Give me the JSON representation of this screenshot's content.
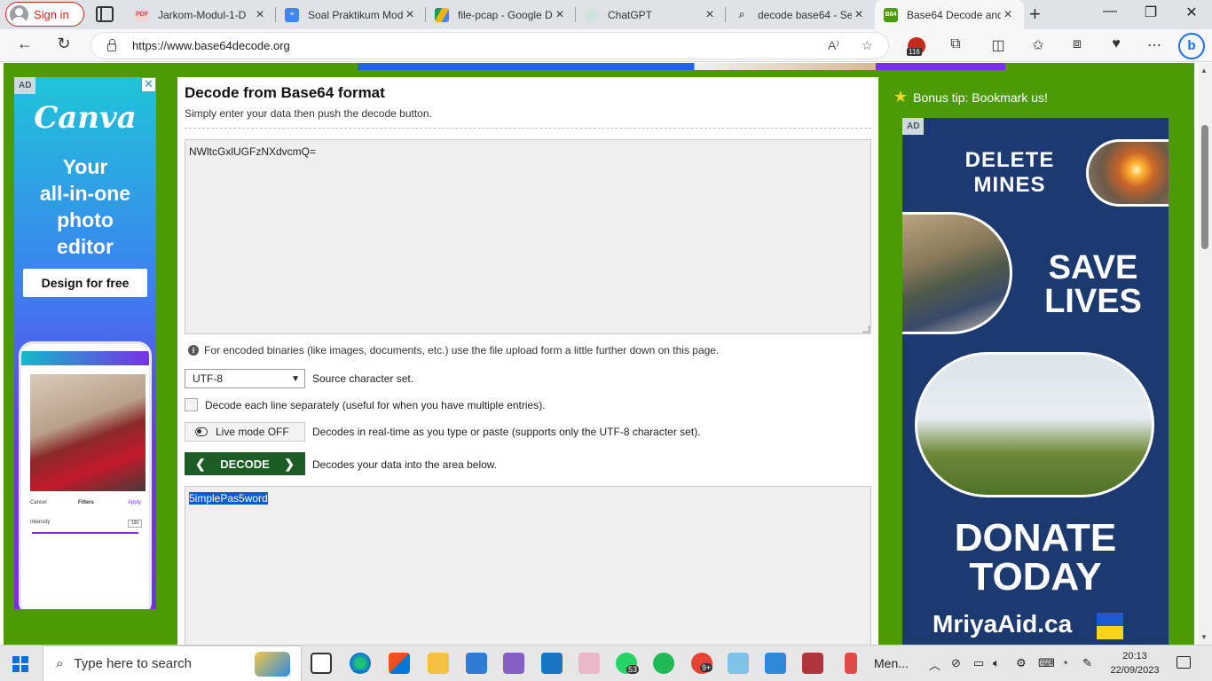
{
  "browser": {
    "signin_label": "Sign in",
    "tabs": [
      {
        "title": "Jarkom-Modul-1-D",
        "favicon": "pdf-icon",
        "color": "#d24a3c"
      },
      {
        "title": "Soal Praktikum Mod",
        "favicon": "google-docs-icon",
        "color": "#4285f4"
      },
      {
        "title": "file-pcap - Google D",
        "favicon": "google-drive-icon",
        "color": "#0f9d58"
      },
      {
        "title": "ChatGPT",
        "favicon": "chatgpt-icon",
        "color": "#74aa9c"
      },
      {
        "title": "decode base64 - Se",
        "favicon": "search-icon",
        "color": "#888888"
      },
      {
        "title": "Base64 Decode and",
        "favicon": "base64-icon",
        "color": "#4b9a06",
        "active": true
      }
    ],
    "url": "https://www.base64decode.org",
    "extension_badge": "116"
  },
  "page": {
    "title": "Decode from Base64 format",
    "subtitle": "Simply enter your data then push the decode button.",
    "input_value": "NWltcGxlUGFzNXdvcmQ=",
    "info_text": "For encoded binaries (like images, documents, etc.) use the file upload form a little further down on this page.",
    "charset_value": "UTF-8",
    "charset_label": "Source character set.",
    "each_line_label": "Decode each line separately (useful for when you have multiple entries).",
    "live_mode_label": "Live mode OFF",
    "live_mode_desc": "Decodes in real-time as you type or paste (supports only the UTF-8 character set).",
    "decode_button": "DECODE",
    "decode_desc": "Decodes your data into the area below.",
    "output_value": "5implePas5word",
    "bonus_tip": "Bonus tip: Bookmark us!"
  },
  "ad_left": {
    "tag": "AD",
    "close": "✕",
    "brand": "Canva",
    "headline_lines": [
      "Your",
      "all-in-one",
      "photo",
      "editor"
    ],
    "cta": "Design for free",
    "phone_cancel": "Cancel",
    "phone_filters": "Filters",
    "phone_apply": "Apply",
    "phone_intensity": "Intensity",
    "phone_intensity_value": "100"
  },
  "ad_right": {
    "tag": "AD",
    "line1": "DELETE",
    "line2": "MINES",
    "line3": "SAVE",
    "line4": "LIVES",
    "line5": "DONATE",
    "line6": "TODAY",
    "brand": "MriyaAid.ca"
  },
  "taskbar": {
    "search_placeholder": "Type here to search",
    "whatsapp_badge": "53",
    "chrome_badge": "9+",
    "pinned_label": "Men...",
    "time": "20:13",
    "date": "22/09/2023"
  },
  "colors": {
    "page_green": "#4b9a06",
    "decode_button": "#1c5d25",
    "selection": "#0a5ad4",
    "edge_accent": "#0a6fd6"
  }
}
